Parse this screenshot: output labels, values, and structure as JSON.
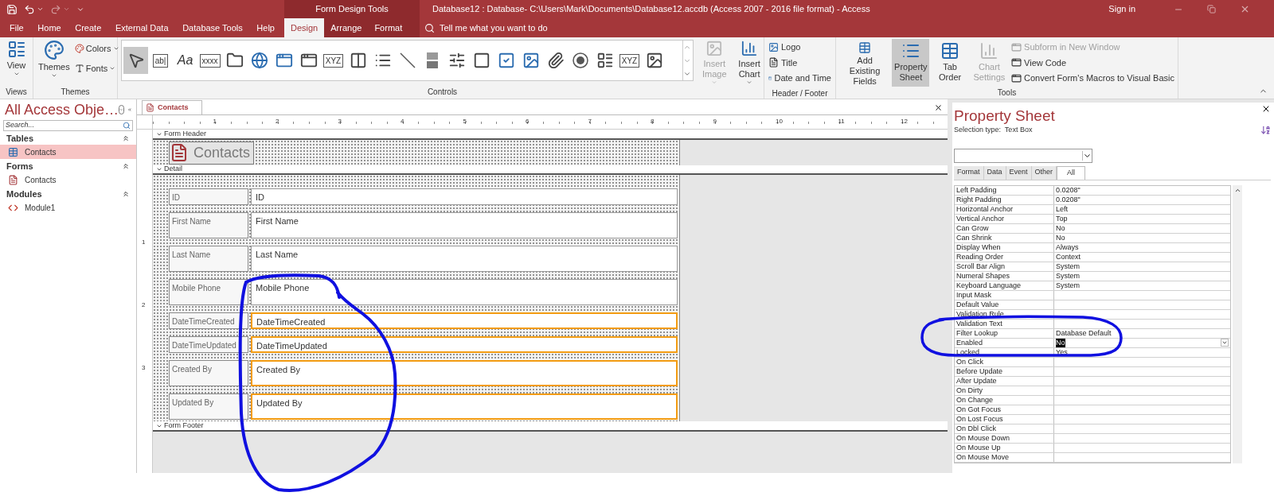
{
  "title_bar": {
    "context_title": "Form Design Tools",
    "window_title": "Database12 : Database- C:\\Users\\Mark\\Documents\\Database12.accdb (Access 2007 - 2016 file format)  -  Access",
    "sign_in": "Sign in"
  },
  "ribbon_tabs": [
    {
      "label": "File",
      "selected": false,
      "contextual": false
    },
    {
      "label": "Home",
      "selected": false,
      "contextual": false
    },
    {
      "label": "Create",
      "selected": false,
      "contextual": false
    },
    {
      "label": "External Data",
      "selected": false,
      "contextual": false
    },
    {
      "label": "Database Tools",
      "selected": false,
      "contextual": false
    },
    {
      "label": "Help",
      "selected": false,
      "contextual": false
    },
    {
      "label": "Design",
      "selected": true,
      "contextual": true
    },
    {
      "label": "Arrange",
      "selected": false,
      "contextual": true
    },
    {
      "label": "Format",
      "selected": false,
      "contextual": true
    }
  ],
  "tell_me": {
    "placeholder": "Tell me what you want to do"
  },
  "views_group": {
    "label": "Views",
    "view_button": "View"
  },
  "themes_group": {
    "label": "Themes",
    "themes_button": "Themes",
    "colors_button": "Colors",
    "fonts_button": "Fonts"
  },
  "controls_group": {
    "label": "Controls",
    "gallery": [
      {
        "selected": true
      },
      {
        "label": "ab|",
        "selected": false
      },
      {
        "label": "Aa",
        "selected": false
      },
      {
        "label": "xxxx",
        "selected": false
      },
      {
        "selected": false
      },
      {
        "selected": false
      },
      {
        "selected": false
      },
      {
        "selected": false
      },
      {
        "label": "XYZ",
        "selected": false
      },
      {
        "selected": false
      },
      {
        "selected": false
      },
      {
        "selected": false
      },
      {
        "selected": false
      },
      {
        "selected": false
      },
      {
        "selected": false
      },
      {
        "selected": false
      },
      {
        "selected": false
      },
      {
        "selected": false
      },
      {
        "selected": false
      },
      {
        "selected": false
      },
      {
        "label": "XYZ",
        "selected": false
      },
      {
        "selected": false
      }
    ],
    "insert_image": {
      "label": "Insert Image",
      "disabled": true
    },
    "insert_chart": {
      "label": "Insert Chart",
      "disabled": false
    }
  },
  "header_footer_group": {
    "label": "Header / Footer",
    "buttons": [
      "Logo",
      "Title",
      "Date and Time"
    ]
  },
  "tools_group": {
    "label": "Tools",
    "large_buttons": [
      {
        "label": "Add Existing Fields",
        "pressed": false,
        "disabled": false
      },
      {
        "label": "Property Sheet",
        "pressed": true,
        "disabled": false
      },
      {
        "label": "Tab Order",
        "pressed": false,
        "disabled": false
      },
      {
        "label": "Chart Settings",
        "pressed": false,
        "disabled": true
      }
    ],
    "small_buttons": [
      {
        "label": "Subform in New Window",
        "disabled": true
      },
      {
        "label": "View Code",
        "disabled": false
      },
      {
        "label": "Convert Form's Macros to Visual Basic",
        "disabled": false
      }
    ]
  },
  "navigation_pane": {
    "title": "All Access Obje…",
    "search": {
      "placeholder": "Search..."
    },
    "groups": [
      {
        "label": "Tables",
        "items": [
          {
            "label": "Contacts",
            "selected": true
          }
        ]
      },
      {
        "label": "Forms",
        "items": [
          {
            "label": "Contacts",
            "selected": false
          }
        ]
      },
      {
        "label": "Modules",
        "items": [
          {
            "label": "Module1",
            "selected": false
          }
        ]
      }
    ]
  },
  "document_tab": {
    "label": "Contacts"
  },
  "ruler": {
    "labels": [
      "1",
      "2",
      "3",
      "4",
      "5",
      "6",
      "7",
      "8",
      "9",
      "10",
      "11",
      "12"
    ],
    "vertical_labels": [
      "1",
      "2",
      "3"
    ]
  },
  "form": {
    "header_bar": "Form Header",
    "title": "Contacts",
    "detail_bar": "Detail",
    "footer_bar": "Form Footer",
    "controls": [
      {
        "label": "ID",
        "field": "ID",
        "kind": "short",
        "selected": false
      },
      {
        "label": "First Name",
        "field": "First Name",
        "kind": "tall",
        "selected": false
      },
      {
        "label": "Last Name",
        "field": "Last Name",
        "kind": "tall",
        "selected": false
      },
      {
        "label": "Mobile Phone",
        "field": "Mobile Phone",
        "kind": "tall",
        "selected": false
      },
      {
        "label": "DateTimeCreated",
        "field": "DateTimeCreated",
        "kind": "short",
        "selected": true
      },
      {
        "label": "DateTimeUpdated",
        "field": "DateTimeUpdated",
        "kind": "short",
        "selected": true
      },
      {
        "label": "Created By",
        "field": "Created By",
        "kind": "tall",
        "selected": true
      },
      {
        "label": "Updated By",
        "field": "Updated By",
        "kind": "tall",
        "selected": true
      }
    ]
  },
  "property_sheet": {
    "title": "Property Sheet",
    "selection_type": "Selection type:  Text Box",
    "tabs": [
      {
        "label": "Format",
        "selected": false
      },
      {
        "label": "Data",
        "selected": false
      },
      {
        "label": "Event",
        "selected": false
      },
      {
        "label": "Other",
        "selected": false
      },
      {
        "label": "All",
        "selected": true
      }
    ],
    "rows": [
      {
        "name": "Left Padding",
        "value": "0.0208\"",
        "selected": false
      },
      {
        "name": "Right Padding",
        "value": "0.0208\"",
        "selected": false
      },
      {
        "name": "Horizontal Anchor",
        "value": "Left",
        "selected": false
      },
      {
        "name": "Vertical Anchor",
        "value": "Top",
        "selected": false
      },
      {
        "name": "Can Grow",
        "value": "No",
        "selected": false
      },
      {
        "name": "Can Shrink",
        "value": "No",
        "selected": false
      },
      {
        "name": "Display When",
        "value": "Always",
        "selected": false
      },
      {
        "name": "Reading Order",
        "value": "Context",
        "selected": false
      },
      {
        "name": "Scroll Bar Align",
        "value": "System",
        "selected": false
      },
      {
        "name": "Numeral Shapes",
        "value": "System",
        "selected": false
      },
      {
        "name": "Keyboard Language",
        "value": "System",
        "selected": false
      },
      {
        "name": "Input Mask",
        "selected": false
      },
      {
        "name": "Default Value",
        "selected": false
      },
      {
        "name": "Validation Rule",
        "selected": false
      },
      {
        "name": "Validation Text",
        "selected": false
      },
      {
        "name": "Filter Lookup",
        "value": "Database Default",
        "selected": false
      },
      {
        "name": "Enabled",
        "value": "No",
        "selected": true
      },
      {
        "name": "Locked",
        "value": "Yes",
        "selected": false
      },
      {
        "name": "On Click",
        "selected": false
      },
      {
        "name": "Before Update",
        "selected": false
      },
      {
        "name": "After Update",
        "selected": false
      },
      {
        "name": "On Dirty",
        "selected": false
      },
      {
        "name": "On Change",
        "selected": false
      },
      {
        "name": "On Got Focus",
        "selected": false
      },
      {
        "name": "On Lost Focus",
        "selected": false
      },
      {
        "name": "On Dbl Click",
        "selected": false
      },
      {
        "name": "On Mouse Down",
        "selected": false
      },
      {
        "name": "On Mouse Up",
        "selected": false
      },
      {
        "name": "On Mouse Move",
        "selected": false
      }
    ]
  }
}
